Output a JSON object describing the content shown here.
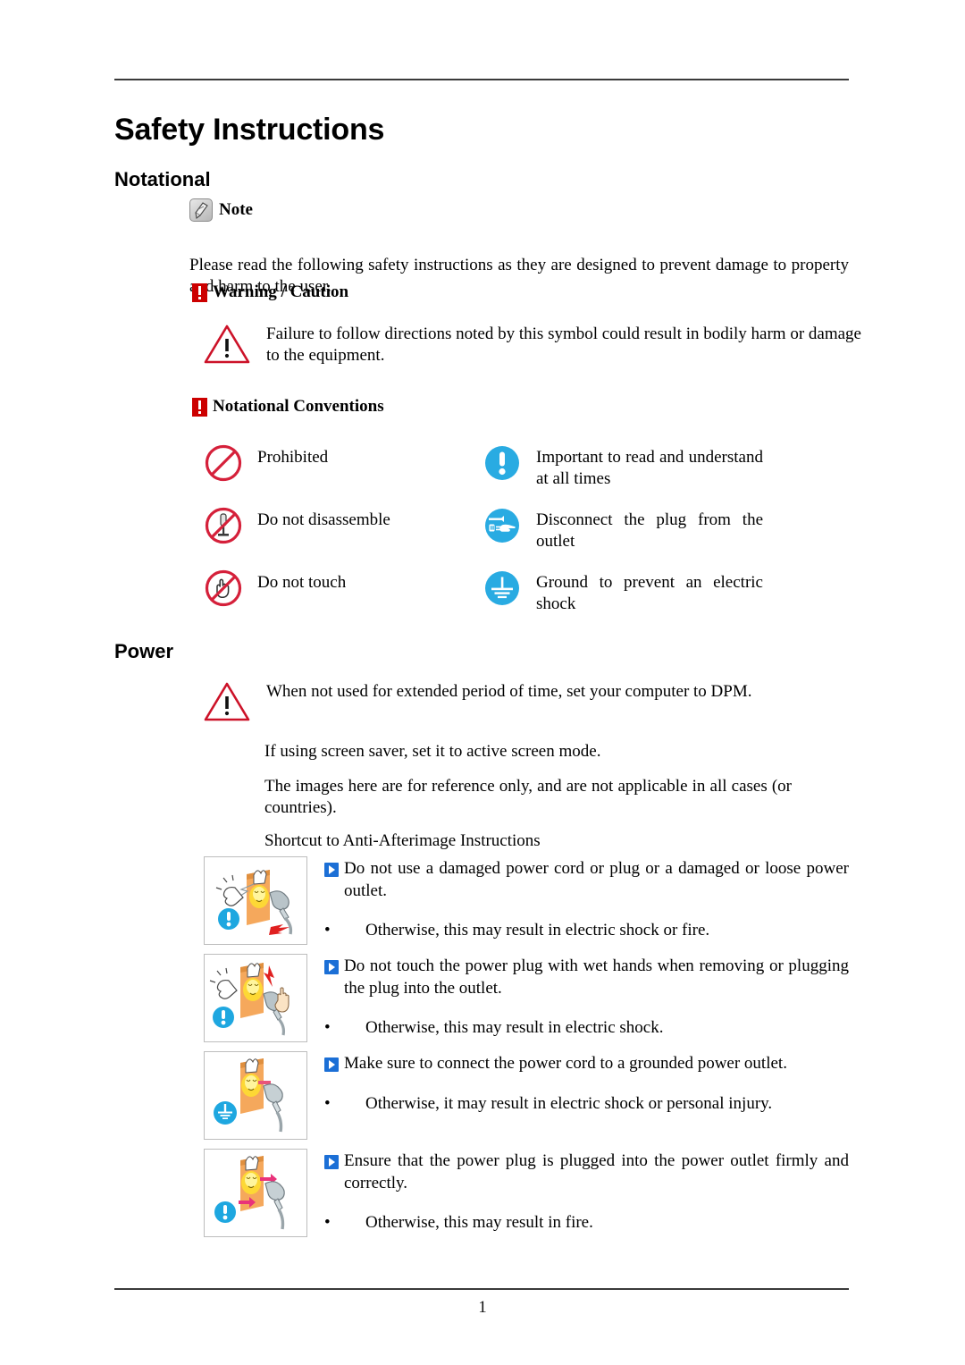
{
  "document": {
    "title": "Safety Instructions",
    "page_number": "1"
  },
  "colors": {
    "warning_red": "#cc0000",
    "info_blue": "#29abe2",
    "arrow_blue": "#1b6fd6",
    "rule_gray": "#3a3a3a"
  },
  "sections": {
    "notational": {
      "heading": "Notational",
      "note": {
        "icon": "note-pen-icon",
        "label": "Note"
      },
      "intro": "Please read the following safety instructions as they are designed to prevent damage to property and harm to the user.",
      "warning_caution": {
        "icon": "red-exclamation-icon",
        "label": "Warning / Caution"
      },
      "caution_text": "Failure to follow directions noted by this symbol could result in bodily harm or damage to the equipment.",
      "conventions_heading": {
        "icon": "red-exclamation-icon",
        "label": "Notational Conventions"
      },
      "conventions": [
        {
          "icon": "prohibited-icon",
          "label": "Prohibited",
          "column": "left"
        },
        {
          "icon": "important-read-icon",
          "label": "Important to read and understand at all times",
          "column": "right"
        },
        {
          "icon": "do-not-disassemble-icon",
          "label": "Do not disassemble",
          "column": "left"
        },
        {
          "icon": "disconnect-plug-icon",
          "label": "Disconnect the plug from the outlet",
          "column": "right"
        },
        {
          "icon": "do-not-touch-icon",
          "label": "Do not touch",
          "column": "left"
        },
        {
          "icon": "ground-icon",
          "label": "Ground to prevent an electric shock",
          "column": "right"
        }
      ]
    },
    "power": {
      "heading": "Power",
      "paragraphs": [
        "When not used for extended period of time, set your computer to DPM.",
        "If using screen saver, set it to active screen mode.",
        "The images here are for reference only, and are not applicable in all cases (or countries).",
        "Shortcut to Anti-Afterimage Instructions"
      ],
      "warnings": [
        {
          "thumb_icon": "damaged-power-cord-illustration",
          "badge": "important-read-icon",
          "main": "Do not use a damaged power cord or plug or a damaged or loose power outlet.",
          "bullet": "•",
          "sub": "Otherwise, this may result in electric shock or fire."
        },
        {
          "thumb_icon": "wet-hands-plug-illustration",
          "badge": "important-read-icon",
          "main": "Do not touch the power plug with wet hands when removing or plugging the plug into the outlet.",
          "bullet": "•",
          "sub": "Otherwise, this may result in electric shock."
        },
        {
          "thumb_icon": "grounded-outlet-illustration",
          "badge": "ground-icon",
          "main": "Make sure to connect the power cord to a grounded power outlet.",
          "bullet": "•",
          "sub": "Otherwise, it may result in electric shock or personal injury."
        },
        {
          "thumb_icon": "plug-firmly-illustration",
          "badge": "important-read-icon",
          "main": "Ensure that the power plug is plugged into the power outlet firmly and correctly.",
          "bullet": "•",
          "sub": "Otherwise, this may result in fire."
        }
      ]
    }
  }
}
